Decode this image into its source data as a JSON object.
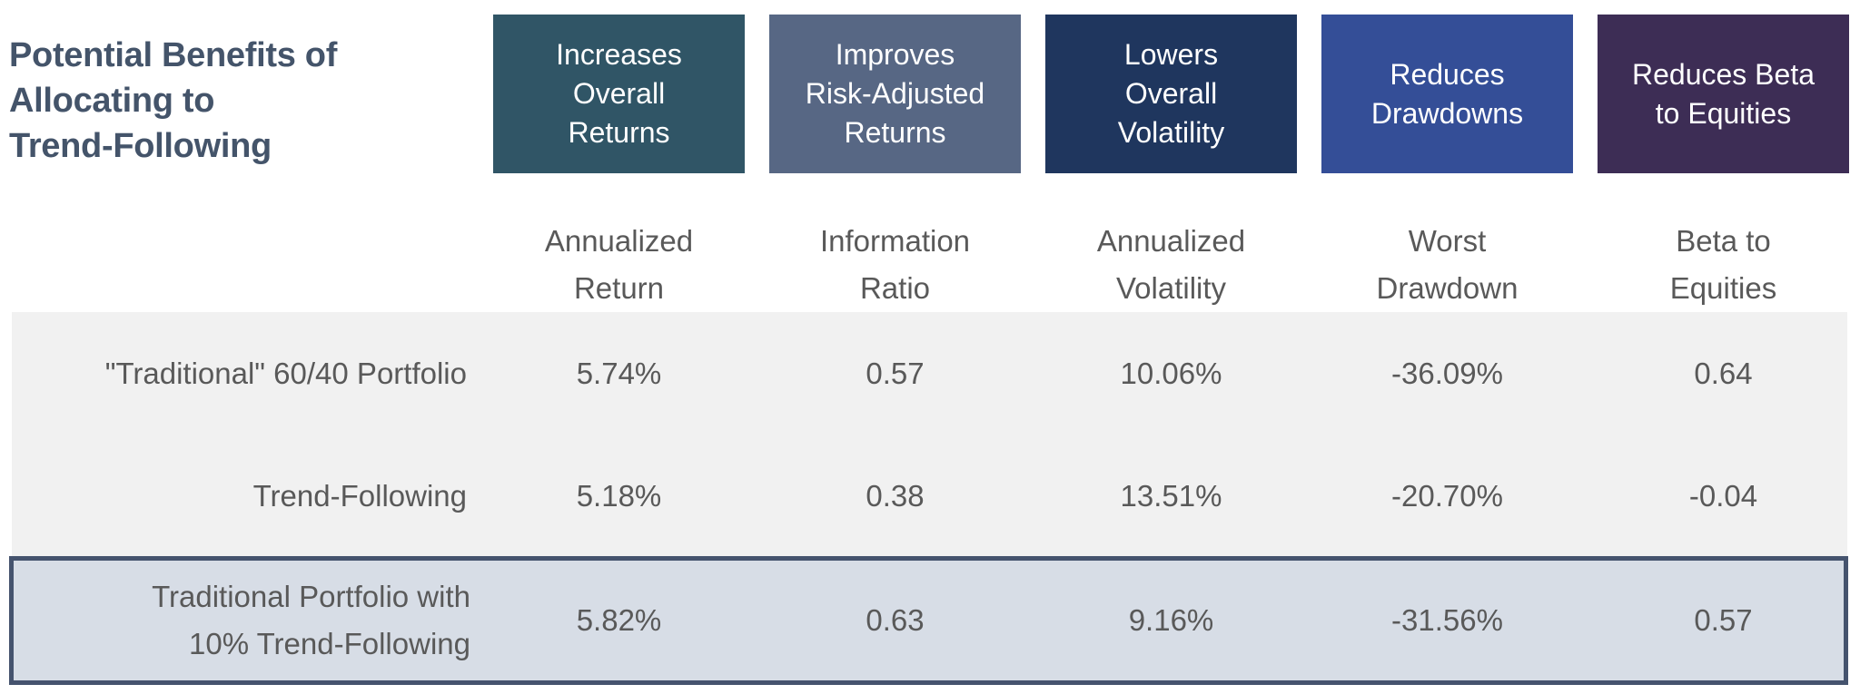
{
  "title": "Potential Benefits of\nAllocating to\nTrend-Following",
  "benefits": [
    {
      "label": "Increases\nOverall\nReturns",
      "color": "#305566"
    },
    {
      "label": "Improves\nRisk-Adjusted\nReturns",
      "color": "#576784"
    },
    {
      "label": "Lowers\nOverall\nVolatility",
      "color": "#1f365e"
    },
    {
      "label": "Reduces\nDrawdowns",
      "color": "#344e97"
    },
    {
      "label": "Reduces Beta\nto Equities",
      "color": "#3d2d55"
    }
  ],
  "columns": [
    "Annualized\nReturn",
    "Information\nRatio",
    "Annualized\nVolatility",
    "Worst\nDrawdown",
    "Beta to\nEquities"
  ],
  "rows": [
    {
      "label": "\"Traditional\" 60/40 Portfolio",
      "values": [
        "5.74%",
        "0.57",
        "10.06%",
        "-36.09%",
        "0.64"
      ]
    },
    {
      "label": "Trend-Following",
      "values": [
        "5.18%",
        "0.38",
        "13.51%",
        "-20.70%",
        "-0.04"
      ]
    },
    {
      "label": "Traditional Portfolio with\n10% Trend-Following",
      "values": [
        "5.82%",
        "0.63",
        "9.16%",
        "-31.56%",
        "0.57"
      ],
      "highlighted": true
    }
  ],
  "colors": {
    "title_text": "#44546a",
    "body_text": "#595959",
    "row_bg": "#f1f1f1",
    "highlight_bg": "#d7dde6",
    "highlight_border": "#45536e"
  }
}
